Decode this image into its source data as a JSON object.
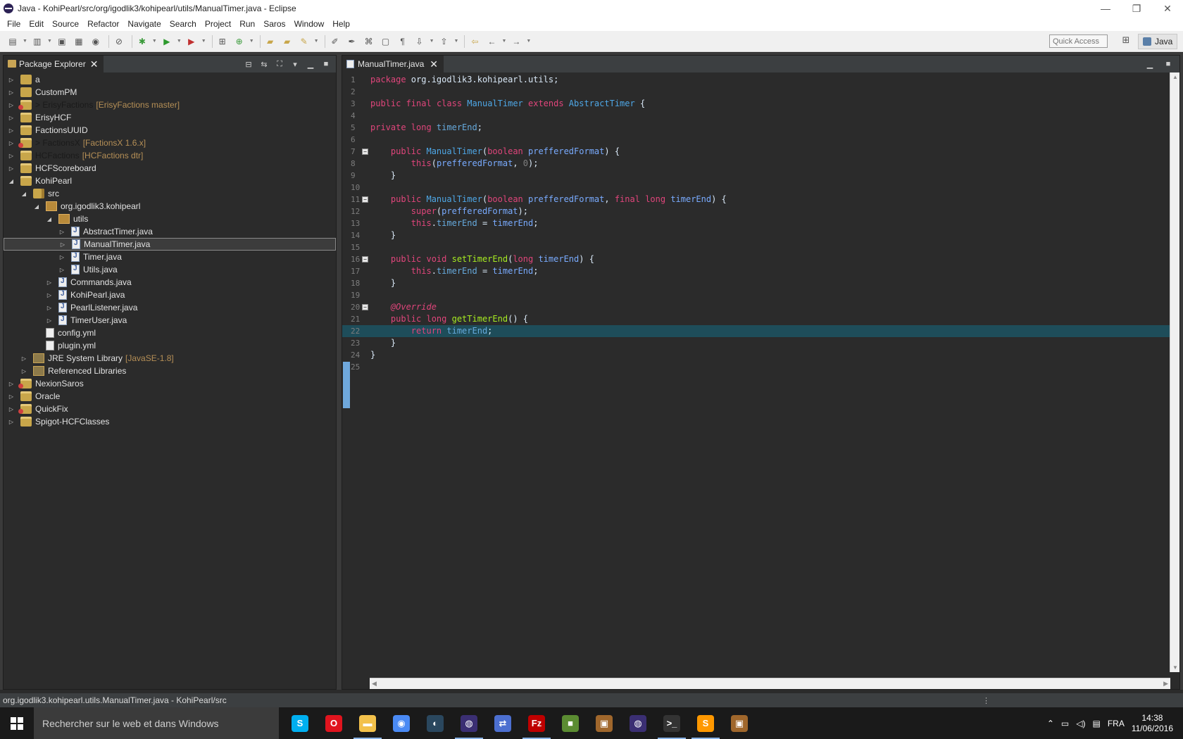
{
  "window": {
    "title": "Java - KohiPearl/src/org/igodlik3/kohipearl/utils/ManualTimer.java - Eclipse",
    "minimize_glyph": "—",
    "restore_glyph": "❐",
    "close_glyph": "✕"
  },
  "menu": [
    "File",
    "Edit",
    "Source",
    "Refactor",
    "Navigate",
    "Search",
    "Project",
    "Run",
    "Saros",
    "Window",
    "Help"
  ],
  "toolbar": {
    "quick_access_placeholder": "Quick Access",
    "perspective_label": "Java"
  },
  "package_explorer": {
    "tab_label": "Package Explorer",
    "close_glyph": "✕",
    "tree": [
      {
        "label": "a",
        "depth": 0,
        "icon": "folder-icon",
        "expanded": false
      },
      {
        "label": "CustomPM",
        "depth": 0,
        "icon": "folder-icon",
        "expanded": false
      },
      {
        "label": "> ErisyFactions",
        "deco": "[ErisyFactions master]",
        "depth": 0,
        "icon": "git-project-icon",
        "expanded": false,
        "dim": true
      },
      {
        "label": "ErisyHCF",
        "depth": 0,
        "icon": "project-icon",
        "expanded": false
      },
      {
        "label": "FactionsUUID",
        "depth": 0,
        "icon": "project-icon",
        "expanded": false
      },
      {
        "label": "> FactionsX",
        "deco": "[FactionsX 1.6.x]",
        "depth": 0,
        "icon": "git-project-icon",
        "expanded": false,
        "dim": true
      },
      {
        "label": "HCFactions",
        "deco": "[HCFactions dtr]",
        "depth": 0,
        "icon": "project-icon",
        "expanded": false,
        "dim": true
      },
      {
        "label": "HCFScoreboard",
        "depth": 0,
        "icon": "project-icon",
        "expanded": false
      },
      {
        "label": "KohiPearl",
        "depth": 0,
        "icon": "project-icon",
        "expanded": true
      },
      {
        "label": "src",
        "depth": 1,
        "icon": "source-folder-icon",
        "expanded": true
      },
      {
        "label": "org.igodlik3.kohipearl",
        "depth": 2,
        "icon": "package-icon",
        "expanded": true
      },
      {
        "label": "utils",
        "depth": 3,
        "icon": "package-icon",
        "expanded": true
      },
      {
        "label": "AbstractTimer.java",
        "depth": 4,
        "icon": "java-file-icon",
        "expanded": false
      },
      {
        "label": "ManualTimer.java",
        "depth": 4,
        "icon": "java-file-icon",
        "expanded": false,
        "selected": true
      },
      {
        "label": "Timer.java",
        "depth": 4,
        "icon": "java-file-icon",
        "expanded": false
      },
      {
        "label": "Utils.java",
        "depth": 4,
        "icon": "java-file-icon",
        "expanded": false
      },
      {
        "label": "Commands.java",
        "depth": 3,
        "icon": "java-file-icon",
        "expanded": false
      },
      {
        "label": "KohiPearl.java",
        "depth": 3,
        "icon": "java-file-icon",
        "expanded": false
      },
      {
        "label": "PearlListener.java",
        "depth": 3,
        "icon": "java-file-icon",
        "expanded": false
      },
      {
        "label": "TimerUser.java",
        "depth": 3,
        "icon": "java-file-icon",
        "expanded": false
      },
      {
        "label": "config.yml",
        "depth": 2,
        "icon": "yml-file-icon",
        "leaf": true
      },
      {
        "label": "plugin.yml",
        "depth": 2,
        "icon": "yml-file-icon",
        "leaf": true
      },
      {
        "label": "JRE System Library",
        "deco": "[JavaSE-1.8]",
        "depth": 1,
        "icon": "library-icon",
        "expanded": false
      },
      {
        "label": "Referenced Libraries",
        "depth": 1,
        "icon": "library-icon",
        "expanded": false
      },
      {
        "label": "NexionSaros",
        "depth": 0,
        "icon": "git-project-icon",
        "expanded": false
      },
      {
        "label": "Oracle",
        "depth": 0,
        "icon": "project-icon",
        "expanded": false
      },
      {
        "label": "QuickFix",
        "depth": 0,
        "icon": "git-project-icon",
        "expanded": false
      },
      {
        "label": "Spigot-HCFClasses",
        "depth": 0,
        "icon": "project-icon",
        "expanded": false
      }
    ]
  },
  "editor": {
    "tab_label": "ManualTimer.java",
    "close_glyph": "✕",
    "current_line": 22,
    "lines": [
      {
        "n": "1",
        "segs": [
          [
            "kw2",
            "package "
          ],
          [
            "pkgtxt",
            "org.igodlik3.kohipearl.utils;"
          ]
        ]
      },
      {
        "n": "2",
        "segs": []
      },
      {
        "n": "3",
        "segs": [
          [
            "kw2",
            "public "
          ],
          [
            "kw2",
            "final "
          ],
          [
            "kw2",
            "class "
          ],
          [
            "typ",
            "ManualTimer "
          ],
          [
            "kw2",
            "extends "
          ],
          [
            "typ",
            "AbstractTimer "
          ],
          [
            "pkgtxt",
            "{"
          ]
        ]
      },
      {
        "n": "4",
        "segs": []
      },
      {
        "n": "5",
        "segs": [
          [
            "kw2",
            "private "
          ],
          [
            "kw2",
            "long "
          ],
          [
            "fld",
            "timerEnd"
          ],
          [
            "pkgtxt",
            ";"
          ]
        ]
      },
      {
        "n": "6",
        "segs": []
      },
      {
        "n": "7",
        "fold": true,
        "segs": [
          [
            "pkgtxt",
            "    "
          ],
          [
            "kw2",
            "public "
          ],
          [
            "typ",
            "ManualTimer"
          ],
          [
            "pkgtxt",
            "("
          ],
          [
            "kw2",
            "boolean "
          ],
          [
            "prm",
            "prefferedFormat"
          ],
          [
            "pkgtxt",
            ") {"
          ]
        ]
      },
      {
        "n": "8",
        "segs": [
          [
            "pkgtxt",
            "        "
          ],
          [
            "kw2",
            "this"
          ],
          [
            "pkgtxt",
            "("
          ],
          [
            "prm",
            "prefferedFormat"
          ],
          [
            "pkgtxt",
            ", "
          ],
          [
            "num",
            "0"
          ],
          [
            "pkgtxt",
            ");"
          ]
        ]
      },
      {
        "n": "9",
        "segs": [
          [
            "pkgtxt",
            "    }"
          ]
        ]
      },
      {
        "n": "10",
        "segs": []
      },
      {
        "n": "11",
        "fold": true,
        "segs": [
          [
            "pkgtxt",
            "    "
          ],
          [
            "kw2",
            "public "
          ],
          [
            "typ",
            "ManualTimer"
          ],
          [
            "pkgtxt",
            "("
          ],
          [
            "kw2",
            "boolean "
          ],
          [
            "prm",
            "prefferedFormat"
          ],
          [
            "pkgtxt",
            ", "
          ],
          [
            "kw2",
            "final "
          ],
          [
            "kw2",
            "long "
          ],
          [
            "prm",
            "timerEnd"
          ],
          [
            "pkgtxt",
            ") {"
          ]
        ]
      },
      {
        "n": "12",
        "segs": [
          [
            "pkgtxt",
            "        "
          ],
          [
            "kw2",
            "super"
          ],
          [
            "pkgtxt",
            "("
          ],
          [
            "prm",
            "prefferedFormat"
          ],
          [
            "pkgtxt",
            ");"
          ]
        ]
      },
      {
        "n": "13",
        "segs": [
          [
            "pkgtxt",
            "        "
          ],
          [
            "kw2",
            "this"
          ],
          [
            "pkgtxt",
            "."
          ],
          [
            "fld",
            "timerEnd"
          ],
          [
            "pkgtxt",
            " = "
          ],
          [
            "prm",
            "timerEnd"
          ],
          [
            "pkgtxt",
            ";"
          ]
        ]
      },
      {
        "n": "14",
        "segs": [
          [
            "pkgtxt",
            "    }"
          ]
        ]
      },
      {
        "n": "15",
        "segs": []
      },
      {
        "n": "16",
        "fold": true,
        "segs": [
          [
            "pkgtxt",
            "    "
          ],
          [
            "kw2",
            "public "
          ],
          [
            "kw2",
            "void "
          ],
          [
            "mth",
            "setTimerEnd"
          ],
          [
            "pkgtxt",
            "("
          ],
          [
            "kw2",
            "long "
          ],
          [
            "prm",
            "timerEnd"
          ],
          [
            "pkgtxt",
            ") {"
          ]
        ]
      },
      {
        "n": "17",
        "segs": [
          [
            "pkgtxt",
            "        "
          ],
          [
            "kw2",
            "this"
          ],
          [
            "pkgtxt",
            "."
          ],
          [
            "fld",
            "timerEnd"
          ],
          [
            "pkgtxt",
            " = "
          ],
          [
            "prm",
            "timerEnd"
          ],
          [
            "pkgtxt",
            ";"
          ]
        ]
      },
      {
        "n": "18",
        "segs": [
          [
            "pkgtxt",
            "    }"
          ]
        ]
      },
      {
        "n": "19",
        "segs": []
      },
      {
        "n": "20",
        "fold": true,
        "segs": [
          [
            "pkgtxt",
            "    "
          ],
          [
            "ann",
            "@Override"
          ]
        ]
      },
      {
        "n": "21",
        "segs": [
          [
            "pkgtxt",
            "    "
          ],
          [
            "kw2",
            "public "
          ],
          [
            "kw2",
            "long "
          ],
          [
            "mth",
            "getTimerEnd"
          ],
          [
            "pkgtxt",
            "() {"
          ]
        ]
      },
      {
        "n": "22",
        "segs": [
          [
            "pkgtxt",
            "        "
          ],
          [
            "kw2",
            "return "
          ],
          [
            "fld",
            "timerEnd"
          ],
          [
            "pkgtxt",
            ";"
          ]
        ]
      },
      {
        "n": "23",
        "segs": [
          [
            "pkgtxt",
            "    }"
          ]
        ]
      },
      {
        "n": "24",
        "segs": [
          [
            "pkgtxt",
            "}"
          ]
        ]
      },
      {
        "n": "25",
        "segs": []
      }
    ]
  },
  "status_bar": {
    "text": "org.igodlik3.kohipearl.utils.ManualTimer.java - KohiPearl/src"
  },
  "taskbar": {
    "search_placeholder": "Rechercher sur le web et dans Windows",
    "apps": [
      {
        "name": "skype-icon",
        "glyph": "S",
        "color": "#00aff0"
      },
      {
        "name": "opera-icon",
        "glyph": "O",
        "color": "#e0141e"
      },
      {
        "name": "file-explorer-icon",
        "glyph": "▬",
        "color": "#f3c14b"
      },
      {
        "name": "chrome-icon",
        "glyph": "◉",
        "color": "#4a8af4"
      },
      {
        "name": "steam-icon",
        "glyph": "◐",
        "color": "#2a475e"
      },
      {
        "name": "eclipse-icon",
        "glyph": "◍",
        "color": "#3b2f73"
      },
      {
        "name": "network-tool-icon",
        "glyph": "⇄",
        "color": "#4c6fd0"
      },
      {
        "name": "filezilla-icon",
        "glyph": "Fz",
        "color": "#bf0000"
      },
      {
        "name": "minecraft-icon",
        "glyph": "■",
        "color": "#5b8c32"
      },
      {
        "name": "package-box-icon",
        "glyph": "▣",
        "color": "#a0672c"
      },
      {
        "name": "eclipse-icon-2",
        "glyph": "◍",
        "color": "#3b2f73"
      },
      {
        "name": "terminal-icon",
        "glyph": ">_",
        "color": "#333333"
      },
      {
        "name": "sublime-icon",
        "glyph": "S",
        "color": "#ff9800"
      },
      {
        "name": "package-box-icon-2",
        "glyph": "▣",
        "color": "#a0672c"
      }
    ],
    "language": "FRA",
    "time": "14:38",
    "date": "11/06/2016"
  }
}
